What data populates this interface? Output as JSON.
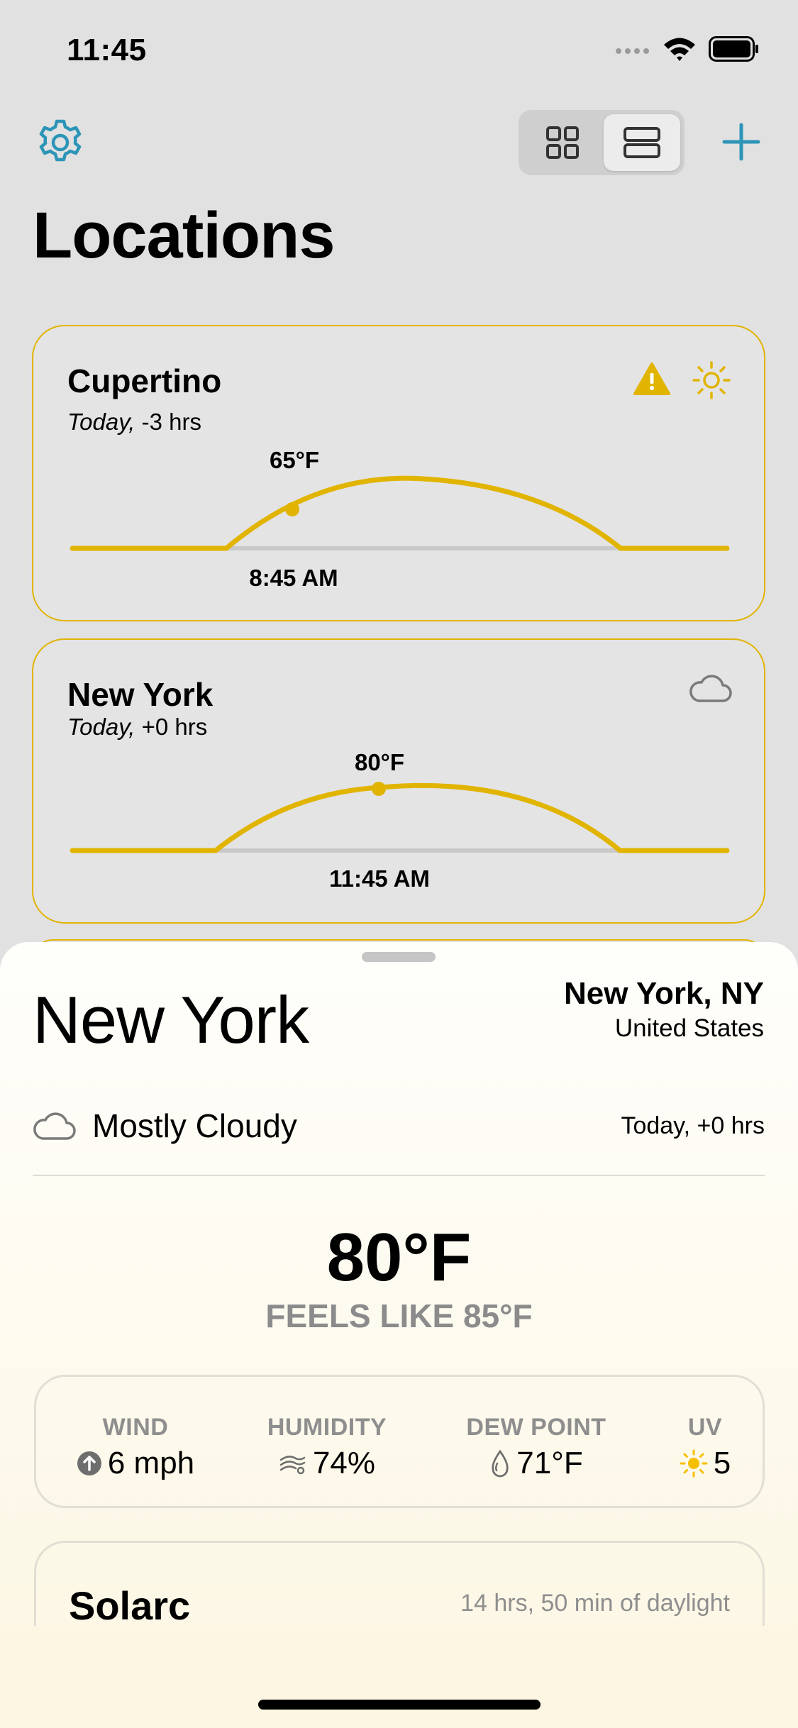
{
  "status_bar": {
    "time": "11:45"
  },
  "header": {
    "title": "Locations",
    "icons": {
      "settings": "gear-icon",
      "grid_view": "grid-view-icon",
      "list_view": "list-view-icon",
      "add": "plus-icon"
    },
    "accent_color": "#2c95b7"
  },
  "locations": [
    {
      "name": "Cupertino",
      "day": "Today,",
      "offset": "-3 hrs",
      "temp": "65°F",
      "time": "8:45 AM",
      "icons": [
        "warning-icon",
        "sun-icon"
      ]
    },
    {
      "name": "New York",
      "day": "Today,",
      "offset": "+0 hrs",
      "temp": "80°F",
      "time": "11:45 AM",
      "icons": [
        "cloud-icon"
      ]
    }
  ],
  "detail": {
    "city": "New York",
    "region": "New York, NY",
    "country": "United States",
    "condition": "Mostly Cloudy",
    "condition_icon": "cloud-icon",
    "time_offset": "Today, +0 hrs",
    "temperature": "80°F",
    "feels_like": "FEELS LIKE 85°F",
    "stats": [
      {
        "label": "WIND",
        "value": "6 mph",
        "icon": "wind-direction-icon"
      },
      {
        "label": "HUMIDITY",
        "value": "74%",
        "icon": "humidity-icon"
      },
      {
        "label": "DEW POINT",
        "value": "71°F",
        "icon": "dew-point-icon"
      },
      {
        "label": "UV",
        "value": "5",
        "icon": "sun-icon"
      }
    ],
    "solarc": {
      "title": "Solarc",
      "daylight": "14 hrs, 50 min of daylight"
    }
  },
  "colors": {
    "arc": "#e1b400",
    "warning": "#e1b400",
    "card_border": "#e1b400"
  }
}
